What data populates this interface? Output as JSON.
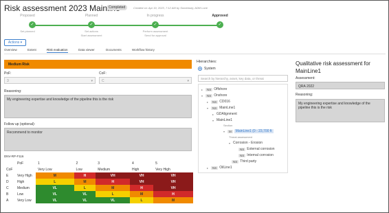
{
  "header": {
    "title": "Risk assessment 2023 Mainline",
    "badge": "Completed",
    "created": "Created on: Apr 19, 2023, 7:12 AM by Somebody, ADM Lone"
  },
  "stepper": {
    "steps": [
      {
        "label": "Proposed",
        "sub1": "Set planned",
        "sub2": ""
      },
      {
        "label": "Planned",
        "sub1": "Set actions",
        "sub2": "Start assessment"
      },
      {
        "label": "In progress",
        "sub1": "Perform assessment",
        "sub2": "Send for approval"
      },
      {
        "label": "Approved",
        "sub1": "",
        "sub2": ""
      }
    ],
    "check": "✓"
  },
  "actions_label": "Actions ▾",
  "tabs": [
    "Overview",
    "Extent",
    "Risk evaluation",
    "Data viewer",
    "Documents",
    "Workflow history"
  ],
  "left": {
    "risk_label": "Medium Risk",
    "pof_label": "PoF:",
    "pof_value": "3",
    "cof_label": "CoF:",
    "cof_value": "C",
    "reasoning_label": "Reasoning:",
    "reasoning_text": "My engineering expertise and knowledge of the pipeline this is the risk",
    "followup_label": "Follow up (optional):",
    "followup_text": "Recommend to monitor",
    "matrix_title": "DNV-RP-F116"
  },
  "matrix": {
    "pof_header": "PoF",
    "cof_header": "CoF",
    "pof_nums": [
      "1",
      "2",
      "3",
      "4",
      "5"
    ],
    "pof_names": [
      "Very Low",
      "Low",
      "Medium",
      "High",
      "Very High"
    ],
    "rows": [
      {
        "letter": "E",
        "name": "Very High",
        "cells": [
          "M",
          "H",
          "VH",
          "VH",
          "VH"
        ]
      },
      {
        "letter": "D",
        "name": "High",
        "cells": [
          "L",
          "M",
          "H",
          "VH",
          "VH"
        ]
      },
      {
        "letter": "C",
        "name": "Medium",
        "cells": [
          "VL",
          "L",
          "M",
          "H",
          "VH"
        ]
      },
      {
        "letter": "B",
        "name": "Low",
        "cells": [
          "VL",
          "VL",
          "L",
          "M",
          "H"
        ]
      },
      {
        "letter": "A",
        "name": "Very Low",
        "cells": [
          "VL",
          "VL",
          "VL",
          "L",
          "M"
        ]
      }
    ],
    "colors": {
      "VL": "#2e8b2e",
      "L": "#f5d000",
      "M": "#f08a00",
      "H": "#d12a2a",
      "VH": "#8b1a1a"
    }
  },
  "hierarchy": {
    "title": "Hierarchies:",
    "system_label": "System",
    "search_placeholder": "Search by hierarchy, asset, key data, or threat",
    "nodes": [
      {
        "tag": "NS",
        "label": "Offshore"
      },
      {
        "tag": "NS",
        "label": "Onshore"
      },
      {
        "tag": "NS",
        "label": "CD016"
      },
      {
        "tag": "NS",
        "label": "MainLine1"
      },
      {
        "tag": "",
        "label": "GDAlignment"
      },
      {
        "tag": "",
        "label": "MainLine1"
      },
      {
        "tag": "",
        "label": "Section"
      },
      {
        "tag": "M",
        "label": "MainLine1 (0 - 23,700 ft"
      },
      {
        "tag": "",
        "label": "Threat assessment"
      },
      {
        "tag": "",
        "label": "Corrosion - Erosion"
      },
      {
        "tag": "NS",
        "label": "External corrosion"
      },
      {
        "tag": "NS",
        "label": "Internal corrosion"
      },
      {
        "tag": "NS",
        "label": "Third party"
      },
      {
        "tag": "NS",
        "label": "OilLine1"
      }
    ]
  },
  "right": {
    "title": "Qualitative risk assessment for MainLine1",
    "assessment_label": "Assessment:",
    "assessment_value": "QRA 2022",
    "reasoning_label": "Reasoning:",
    "reasoning_text": "My engineering expertise and knowledge of the pipeline this is the risk"
  }
}
